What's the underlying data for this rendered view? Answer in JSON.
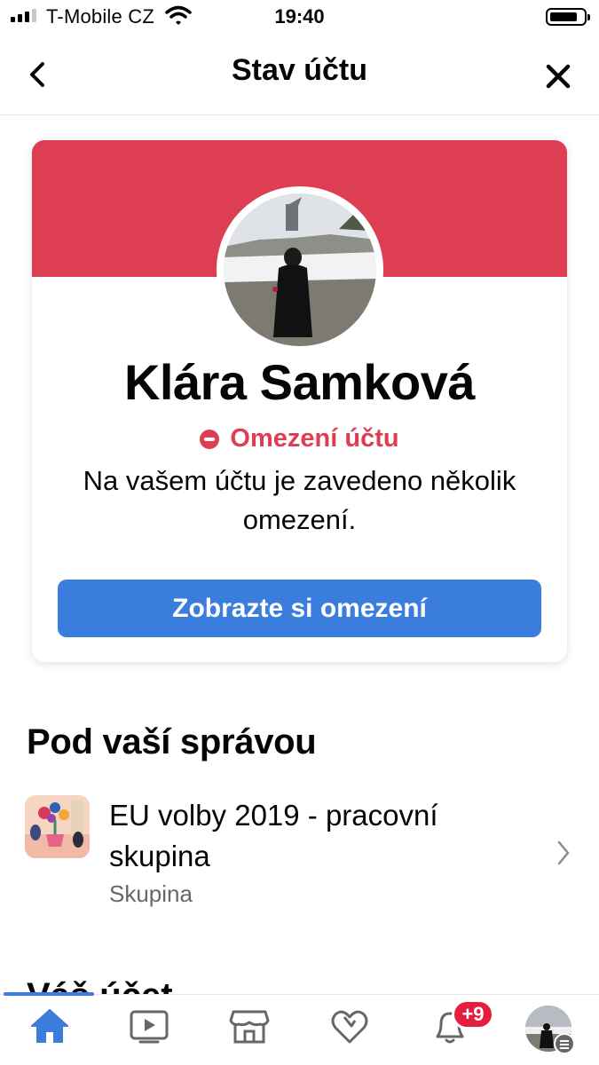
{
  "status_bar": {
    "carrier": "T-Mobile CZ",
    "time": "19:40"
  },
  "header": {
    "title": "Stav účtu",
    "back_icon": "chevron-left-icon",
    "close_icon": "close-icon"
  },
  "profile": {
    "name": "Klára Samková",
    "status_label": "Omezení účtu",
    "status_description": "Na vašem účtu je zavedeno několik omezení.",
    "button_label": "Zobrazte si omezení"
  },
  "managed": {
    "title": "Pod vaší správou",
    "items": [
      {
        "name": "EU volby 2019 - pracovní skupina",
        "type": "Skupina"
      }
    ]
  },
  "next_section": {
    "title": "Váš účet"
  },
  "tabbar": {
    "tabs": [
      {
        "label": "home",
        "icon": "home-icon",
        "active": true
      },
      {
        "label": "video",
        "icon": "video-icon",
        "active": false
      },
      {
        "label": "marketplace",
        "icon": "marketplace-icon",
        "active": false
      },
      {
        "label": "dating",
        "icon": "heart-icon",
        "active": false
      },
      {
        "label": "notifications",
        "icon": "bell-icon",
        "active": false
      },
      {
        "label": "menu",
        "icon": "profile-avatar-icon",
        "active": false
      }
    ],
    "notification_badge": "+9"
  },
  "colors": {
    "banner_red": "#de3e52",
    "accent_blue": "#3b7ddd",
    "badge_red": "#e41e3f",
    "secondary_text": "#65676b"
  }
}
